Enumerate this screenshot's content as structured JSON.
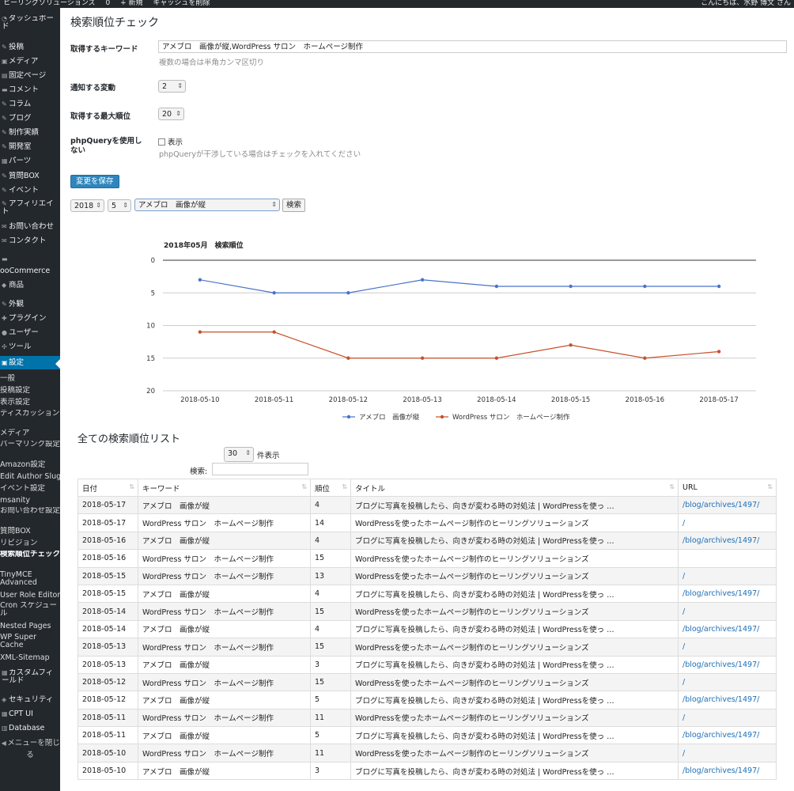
{
  "admin_bar": {
    "items": [
      "ヒーリングソリューションズ",
      "0",
      "+ 新規",
      "キャッシュを削除"
    ],
    "greeting": "こんにちは、水野 博文 さん"
  },
  "sidebar": {
    "items": [
      {
        "icon": "dashboard-icon",
        "label": "ダッシュボード"
      },
      {
        "icon": "pin-icon",
        "label": "投稿"
      },
      {
        "icon": "media-icon",
        "label": "メディア"
      },
      {
        "icon": "page-icon",
        "label": "固定ページ"
      },
      {
        "icon": "comment-icon",
        "label": "コメント"
      },
      {
        "icon": "pin-icon",
        "label": "コラム"
      },
      {
        "icon": "pin-icon",
        "label": "ブログ"
      },
      {
        "icon": "pin-icon",
        "label": "制作実績"
      },
      {
        "icon": "pin-icon",
        "label": "開発室"
      },
      {
        "icon": "grid-icon",
        "label": "パーツ"
      },
      {
        "icon": "pin-icon",
        "label": "質問BOX"
      },
      {
        "icon": "pin-icon",
        "label": "イベント"
      },
      {
        "icon": "pin-icon",
        "label": "アフィリエイト"
      },
      {
        "icon": "mail-icon",
        "label": "お問い合わせ"
      },
      {
        "icon": "mail-icon",
        "label": "コンタクト"
      },
      {
        "icon": "cart-icon",
        "label": "ooCommerce"
      },
      {
        "icon": "tag-icon",
        "label": "商品"
      },
      {
        "icon": "brush-icon",
        "label": "外観"
      },
      {
        "icon": "plugin-icon",
        "label": "プラグイン"
      },
      {
        "icon": "user-icon",
        "label": "ユーザー"
      },
      {
        "icon": "tool-icon",
        "label": "ツール"
      },
      {
        "icon": "settings-icon",
        "label": "設定"
      }
    ],
    "submenu": [
      "一般",
      "投稿設定",
      "表示設定",
      "ディスカッション",
      "メディア",
      "パーマリンク設定",
      "Amazon設定",
      "Edit Author Slug",
      "イベント設定",
      "msanity",
      "お問い合わせ設定",
      "質問BOX",
      "リビジョン",
      "検索順位チェック",
      "TinyMCE Advanced",
      "User Role Editor",
      "Cron スケジュール",
      "Nested Pages",
      "WP Super Cache",
      "XML-Sitemap"
    ],
    "bottom_items": [
      {
        "icon": "grid-icon",
        "label": "カスタムフィールド"
      },
      {
        "icon": "shield-icon",
        "label": "セキュリティ"
      },
      {
        "icon": "grid-icon",
        "label": "CPT UI"
      },
      {
        "icon": "database-icon",
        "label": "Database"
      },
      {
        "icon": "collapse-icon",
        "label": "メニューを閉じる"
      }
    ]
  },
  "page": {
    "title": "検索順位チェック",
    "keyword_label": "取得するキーワード",
    "keyword_value": "アメブロ　画像が縦,WordPress サロン　ホームページ制作",
    "keyword_desc": "複数の場合は半角カンマ区切り",
    "notify_label": "通知する変動",
    "notify_value": "2",
    "max_label": "取得する最大順位",
    "max_value": "20",
    "phpquery_label": "phpQueryを使用しない",
    "phpquery_checkbox_label": "表示",
    "phpquery_desc": "phpQueryが干渉している場合はチェックを入れてください",
    "save_button": "変更を保存",
    "year_value": "2018",
    "month_value": "5",
    "keyword_select_value": "アメブロ　画像が縦",
    "search_button": "検索"
  },
  "chart_data": {
    "type": "line",
    "title": "2018年05月　検索順位",
    "x": [
      "2018-05-10",
      "2018-05-11",
      "2018-05-12",
      "2018-05-13",
      "2018-05-14",
      "2018-05-15",
      "2018-05-16",
      "2018-05-17"
    ],
    "ylim": [
      0,
      20
    ],
    "y_reversed": true,
    "y_ticks": [
      0,
      5,
      10,
      15,
      20
    ],
    "grid": true,
    "legend_position": "bottom",
    "series": [
      {
        "name": "アメブロ　画像が縦",
        "color": "#4a73c9",
        "values": [
          3,
          5,
          5,
          3,
          4,
          4,
          4,
          4
        ]
      },
      {
        "name": "WordPress サロン　ホームページ制作",
        "color": "#c8502a",
        "values": [
          11,
          11,
          15,
          15,
          15,
          13,
          15,
          14
        ]
      }
    ]
  },
  "list": {
    "heading": "全ての検索順位リスト",
    "length_value": "30",
    "length_label": "件表示",
    "search_label": "検索:",
    "columns": [
      "日付",
      "キーワード",
      "順位",
      "タイトル",
      "URL"
    ],
    "rows": [
      [
        "2018-05-17",
        "アメブロ　画像が縦",
        "4",
        "ブログに写真を投稿したら、向きが変わる時の対処法 | WordPressを使っ …",
        "/blog/archives/1497/"
      ],
      [
        "2018-05-17",
        "WordPress サロン　ホームページ制作",
        "14",
        "WordPressを使ったホームページ制作のヒーリングソリューションズ",
        "/"
      ],
      [
        "2018-05-16",
        "アメブロ　画像が縦",
        "4",
        "ブログに写真を投稿したら、向きが変わる時の対処法 | WordPressを使っ …",
        "/blog/archives/1497/"
      ],
      [
        "2018-05-16",
        "WordPress サロン　ホームページ制作",
        "15",
        "WordPressを使ったホームページ制作のヒーリングソリューションズ",
        ""
      ],
      [
        "2018-05-15",
        "WordPress サロン　ホームページ制作",
        "13",
        "WordPressを使ったホームページ制作のヒーリングソリューションズ",
        "/"
      ],
      [
        "2018-05-15",
        "アメブロ　画像が縦",
        "4",
        "ブログに写真を投稿したら、向きが変わる時の対処法 | WordPressを使っ …",
        "/blog/archives/1497/"
      ],
      [
        "2018-05-14",
        "WordPress サロン　ホームページ制作",
        "15",
        "WordPressを使ったホームページ制作のヒーリングソリューションズ",
        "/"
      ],
      [
        "2018-05-14",
        "アメブロ　画像が縦",
        "4",
        "ブログに写真を投稿したら、向きが変わる時の対処法 | WordPressを使っ …",
        "/blog/archives/1497/"
      ],
      [
        "2018-05-13",
        "WordPress サロン　ホームページ制作",
        "15",
        "WordPressを使ったホームページ制作のヒーリングソリューションズ",
        "/"
      ],
      [
        "2018-05-13",
        "アメブロ　画像が縦",
        "3",
        "ブログに写真を投稿したら、向きが変わる時の対処法 | WordPressを使っ …",
        "/blog/archives/1497/"
      ],
      [
        "2018-05-12",
        "WordPress サロン　ホームページ制作",
        "15",
        "WordPressを使ったホームページ制作のヒーリングソリューションズ",
        "/"
      ],
      [
        "2018-05-12",
        "アメブロ　画像が縦",
        "5",
        "ブログに写真を投稿したら、向きが変わる時の対処法 | WordPressを使っ …",
        "/blog/archives/1497/"
      ],
      [
        "2018-05-11",
        "WordPress サロン　ホームページ制作",
        "11",
        "WordPressを使ったホームページ制作のヒーリングソリューションズ",
        "/"
      ],
      [
        "2018-05-11",
        "アメブロ　画像が縦",
        "5",
        "ブログに写真を投稿したら、向きが変わる時の対処法 | WordPressを使っ …",
        "/blog/archives/1497/"
      ],
      [
        "2018-05-10",
        "WordPress サロン　ホームページ制作",
        "11",
        "WordPressを使ったホームページ制作のヒーリングソリューションズ",
        "/"
      ],
      [
        "2018-05-10",
        "アメブロ　画像が縦",
        "3",
        "ブログに写真を投稿したら、向きが変わる時の対処法 | WordPressを使っ …",
        "/blog/archives/1497/"
      ]
    ]
  }
}
